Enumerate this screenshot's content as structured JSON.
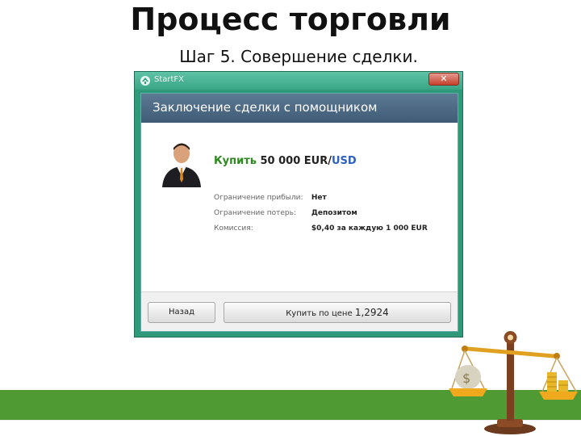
{
  "slide": {
    "title": "Процесс торговли",
    "subtitle": "Шаг 5. Совершение сделки."
  },
  "window": {
    "app_name": "StartFX",
    "close_symbol": "✕",
    "header_title": "Заключение сделки с помощником",
    "deal": {
      "buy_word": "Купить",
      "amount": "50 000 EUR/",
      "quote_currency": "USD"
    },
    "info": [
      {
        "label": "Ограничение прибыли:",
        "value": "Нет"
      },
      {
        "label": "Ограничение потерь:",
        "value": "Депозитом"
      },
      {
        "label": "Комиссия:",
        "value": "$0,40 за каждую 1 000 EUR"
      }
    ],
    "buttons": {
      "back": "Назад",
      "buy_prefix": "Купить по цене",
      "buy_price": "1,2924"
    }
  },
  "icons": {
    "app_logo": "startfx-logo-icon",
    "avatar": "businessman-avatar-icon",
    "scales": "balance-scales-icon"
  },
  "colors": {
    "window_frame": "#2f9a7a",
    "header": "#4a6784",
    "buy_green": "#2d8a1e",
    "usd_blue": "#2f5fc0",
    "band_green": "#4f9a33",
    "close_red": "#c5402c"
  }
}
